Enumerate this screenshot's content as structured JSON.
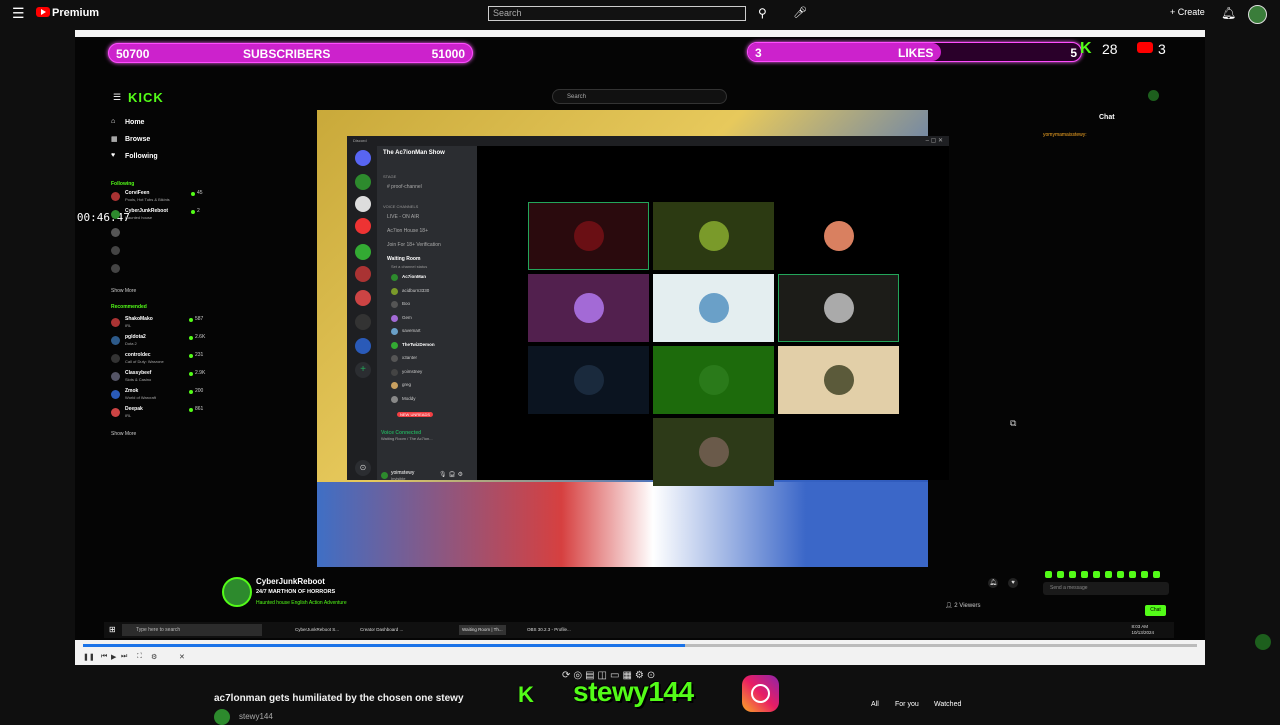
{
  "youtube": {
    "premium_label": "Premium",
    "search_placeholder": "Search",
    "create_label": "Create",
    "video_title": "ac7lonman gets humiliated by the chosen one stewy",
    "channel_name": "stewy144",
    "filters": [
      "All",
      "For you",
      "Watched"
    ]
  },
  "overlay": {
    "subs_current": "50700",
    "subs_label": "SUBSCRIBERS",
    "subs_goal": "51000",
    "likes_current": "3",
    "likes_label": "LIKES",
    "likes_goal": "5",
    "kick_count": "28",
    "yt_count": "3",
    "timestamp": "22/04/2026 00:46:47",
    "handle": "stewy144"
  },
  "kick": {
    "logo": "KICK",
    "search_placeholder": "Search",
    "nav": [
      "Home",
      "Browse",
      "Following"
    ],
    "following_header": "Following",
    "following": [
      {
        "name": "CorviFeen",
        "sub": "Pools, Hot Tubs & Bikinis",
        "count": "45"
      },
      {
        "name": "CyberJunkReboot",
        "sub": "Haunted house",
        "count": "2"
      }
    ],
    "show_more": "Show More",
    "recommended_header": "Recommended",
    "recommended": [
      {
        "name": "ShakoMako",
        "sub": "IRL",
        "count": "587"
      },
      {
        "name": "pgldota2",
        "sub": "Dota 2",
        "count": "2.6K"
      },
      {
        "name": "controldec",
        "sub": "Call of Duty: Warzone",
        "count": "231"
      },
      {
        "name": "Classybeef",
        "sub": "Slots & Casino",
        "count": "2.9K"
      },
      {
        "name": "Zmok",
        "sub": "World of Warcraft",
        "count": "200"
      },
      {
        "name": "Deepak",
        "sub": "IRL",
        "count": "861"
      }
    ],
    "chat_title": "Chat",
    "chat_user": "yomymamaisstewy:",
    "chat_placeholder": "Send a message",
    "chat_button": "Chat",
    "streamer": {
      "name": "CyberJunkReboot",
      "title": "24/7 MARTHON OF HORRORS",
      "tags": "Haunted house   English   Action   Adventure",
      "viewers": "2 Viewers"
    }
  },
  "discord": {
    "app_name": "Discord",
    "server_name": "The Ac7ionMan Show",
    "stage_label": "STAGE",
    "text_channel": "proof-channel",
    "voice_label": "VOICE CHANNELS",
    "channels": [
      "LIVE - ON AIR",
      "Ac7ion House 18+",
      "Join For 18+ Verification",
      "Waiting Room"
    ],
    "waiting_sub": "Set a channel status",
    "users": [
      "Ac7ionMan",
      "acidburn3330",
      "Boo",
      "Gem",
      "savemart",
      "TheTwizDemon",
      "x3anter",
      "yoimstney",
      "greg",
      "Moddy"
    ],
    "new_unreads": "NEW UNREADS",
    "voice_connected": "Voice Connected",
    "voice_sub": "Waiting Room / The Ac7ion...",
    "me_name": "yoimstewy",
    "me_status": "Invisible"
  },
  "taskbar": {
    "search_placeholder": "Type here to search",
    "apps": [
      "CyberJunkReboot S...",
      "Creator Dashboard ...",
      "Waiting Room | Th...",
      "OBS 30.2.3 - Profile..."
    ],
    "time": "8:03 AM",
    "date": "10/13/2024"
  },
  "colors": {
    "kick_green": "#53fc18",
    "bar_magenta": "#cc22cc",
    "yt_red": "#ff0000"
  }
}
